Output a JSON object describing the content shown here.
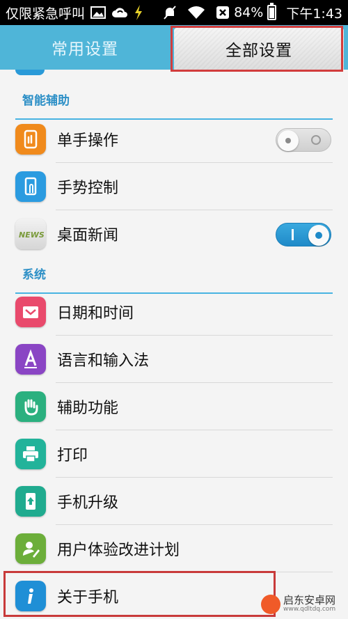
{
  "status_bar": {
    "carrier": "仅限紧急呼叫",
    "battery": "84%",
    "time": "下午1:43"
  },
  "tabs": [
    {
      "label": "常用设置",
      "active": false
    },
    {
      "label": "全部设置",
      "active": true
    }
  ],
  "sections": [
    {
      "title": "智能辅助",
      "items": [
        {
          "label": "单手操作",
          "icon": "one-hand-icon",
          "color": "#f08a1c",
          "toggle": "off"
        },
        {
          "label": "手势控制",
          "icon": "gesture-icon",
          "color": "#2b9be0"
        },
        {
          "label": "桌面新闻",
          "icon": "news-icon",
          "color": "#9bb84a",
          "toggle": "on"
        }
      ]
    },
    {
      "title": "系统",
      "items": [
        {
          "label": "日期和时间",
          "icon": "clock-icon",
          "color": "#e94a6c"
        },
        {
          "label": "语言和输入法",
          "icon": "language-icon",
          "color": "#8a45c4"
        },
        {
          "label": "辅助功能",
          "icon": "hand-icon",
          "color": "#2bb07f"
        },
        {
          "label": "打印",
          "icon": "printer-icon",
          "color": "#22b39a"
        },
        {
          "label": "手机升级",
          "icon": "upgrade-icon",
          "color": "#20ab8f"
        },
        {
          "label": "用户体验改进计划",
          "icon": "user-edit-icon",
          "color": "#6cae3a"
        },
        {
          "label": "关于手机",
          "icon": "info-icon",
          "color": "#1f8fd6"
        }
      ]
    }
  ],
  "watermark": {
    "name": "启东安卓网",
    "url": "www.qdltdq.com"
  }
}
